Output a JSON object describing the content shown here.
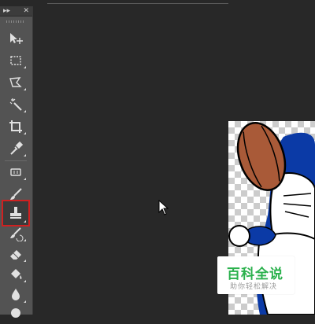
{
  "toolbar": {
    "collapse_label": "▸▸",
    "close_label": "✕",
    "tools": [
      {
        "name": "move-tool",
        "icon": "move-icon"
      },
      {
        "name": "rectangular-marquee-tool",
        "icon": "marquee-icon"
      },
      {
        "name": "polygonal-lasso-tool",
        "icon": "lasso-icon"
      },
      {
        "name": "magic-wand-tool",
        "icon": "magic-wand-icon"
      },
      {
        "name": "crop-tool",
        "icon": "crop-icon"
      },
      {
        "name": "eyedropper-tool",
        "icon": "eyedropper-icon"
      },
      {
        "name": "spot-healing-brush-tool",
        "icon": "bandage-icon"
      },
      {
        "name": "brush-tool",
        "icon": "brush-icon"
      },
      {
        "name": "clone-stamp-tool",
        "icon": "stamp-icon",
        "active": true
      },
      {
        "name": "history-brush-tool",
        "icon": "history-brush-icon"
      },
      {
        "name": "eraser-tool",
        "icon": "eraser-icon"
      },
      {
        "name": "paint-bucket-tool",
        "icon": "bucket-icon"
      },
      {
        "name": "blur-tool",
        "icon": "blur-icon"
      },
      {
        "name": "dodge-tool",
        "icon": "dodge-icon"
      }
    ],
    "active_highlight_color": "#d02020"
  },
  "watermark": {
    "title": "百科全说",
    "subtitle": "助你轻松解决",
    "title_color": "#2bb14d"
  },
  "canvas": {
    "subject": "doraemon-with-football-image"
  }
}
